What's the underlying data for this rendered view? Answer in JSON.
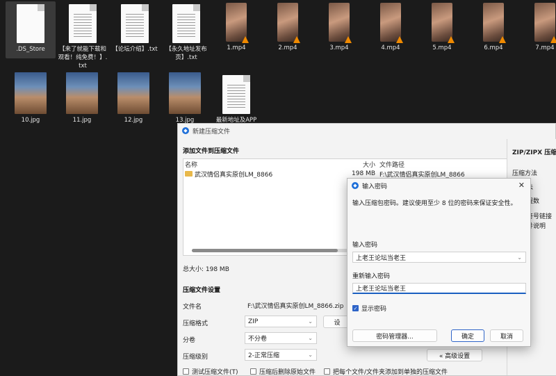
{
  "desktop": {
    "files": [
      {
        "name": ".DS_Store",
        "type": "doc"
      },
      {
        "name": "【来了就能下载和观看！纯免费！】.txt",
        "type": "doc"
      },
      {
        "name": "【论坛介绍】.txt",
        "type": "doc"
      },
      {
        "name": "【永久地址发布页】.txt",
        "type": "doc"
      },
      {
        "name": "1.mp4",
        "type": "video"
      },
      {
        "name": "2.mp4",
        "type": "video"
      },
      {
        "name": "3.mp4",
        "type": "video"
      },
      {
        "name": "4.mp4",
        "type": "video"
      },
      {
        "name": "5.mp4",
        "type": "video"
      },
      {
        "name": "6.mp4",
        "type": "video"
      },
      {
        "name": "7.mp4",
        "type": "video"
      },
      {
        "name": "10.jpg",
        "type": "image"
      },
      {
        "name": "11.jpg",
        "type": "image"
      },
      {
        "name": "12.jpg",
        "type": "image"
      },
      {
        "name": "13.jpg",
        "type": "image"
      },
      {
        "name": "最新地址及APP",
        "type": "doc"
      }
    ]
  },
  "compress_window": {
    "title": "新建压缩文件",
    "add_files_heading": "添加文件到压缩文件",
    "columns": {
      "name": "名称",
      "size": "大小",
      "path": "文件路径"
    },
    "rows": [
      {
        "name": "武汉情侣真实原创LM_8866",
        "size": "198 MB",
        "path": "F:\\武汉情侣真实原创LM_8866"
      }
    ],
    "total_size": "总大小: 198 MB",
    "settings_heading": "压缩文件设置",
    "filename_label": "文件名",
    "filename_value": "F:\\武汉情侣真实原创LM_8866.zip",
    "format_label": "压缩格式",
    "format_value": "ZIP",
    "split_label": "分卷",
    "split_value": "不分卷",
    "level_label": "压缩级别",
    "level_value": "2-正常压缩",
    "setpwd_partial": "设",
    "advanced_button": "« 高级设置",
    "checkbox_test": "测试压缩文件(T)",
    "checkbox_delete": "压缩后删除原始文件",
    "checkbox_separate": "把每个文件/文件夹添加到单独的压缩文件",
    "right_panel": {
      "heading": "ZIP/ZIPX 压缩设",
      "items": [
        "压缩方法",
        "法",
        "程数",
        "符号链接",
        "并说明"
      ]
    }
  },
  "password_dialog": {
    "title": "输入密码",
    "description": "输入压缩包密码。建议使用至少 8 位的密码来保证安全性。",
    "password_label": "输入密码",
    "password_value": "上老王论坛当老王",
    "reenter_label": "重新输入密码",
    "reenter_value": "上老王论坛当老王",
    "show_password_label": "显示密码",
    "show_password_checked": true,
    "manager_button": "密码管理器...",
    "ok_button": "确定",
    "cancel_button": "取消"
  },
  "colors": {
    "desktop_bg": "#1b1b1b",
    "accent": "#2e64c8"
  }
}
